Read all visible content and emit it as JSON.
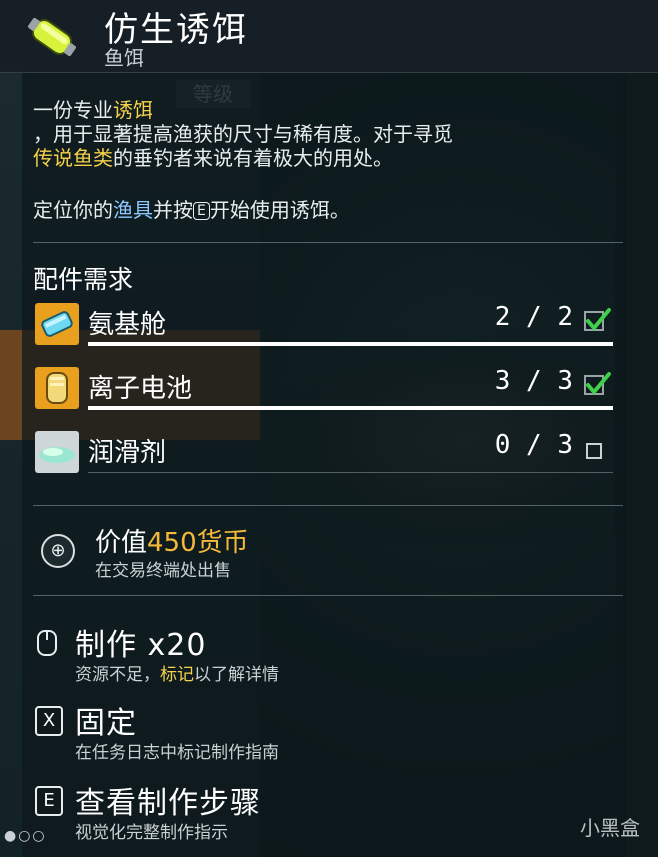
{
  "header": {
    "title": "仿生诱饵",
    "subtitle": "鱼饵",
    "icon": "battery-bait-icon"
  },
  "background": {
    "level_tag": "等级"
  },
  "description": {
    "line1_prefix": "一份专业",
    "line1_highlight": "诱饵",
    "line2": "，用于显著提高渔获的尺寸与稀有度。对于寻觅",
    "line3_highlight": "传说鱼类",
    "line3_suffix": "的垂钓者来说有着极大的用处。",
    "locate_prefix": "定位你的",
    "locate_highlight": "渔具",
    "locate_mid": "并按",
    "locate_key": "E",
    "locate_suffix": "开始使用诱饵。"
  },
  "requirements": {
    "label": "配件需求",
    "items": [
      {
        "name": "氨基舱",
        "have": "2",
        "need": "2",
        "count": "2 / 2",
        "met": true,
        "icon": "amino-chamber-icon",
        "progress": 1.0
      },
      {
        "name": "离子电池",
        "have": "3",
        "need": "3",
        "count": "3 / 3",
        "met": true,
        "icon": "ion-battery-icon",
        "progress": 1.0
      },
      {
        "name": "润滑剂",
        "have": "0",
        "need": "3",
        "count": "0 / 3",
        "met": false,
        "icon": "lubricant-icon",
        "progress": 0.0
      }
    ]
  },
  "value": {
    "prefix": "价值",
    "amount": "450货币",
    "sub": "在交易终端处出售"
  },
  "actions": {
    "craft": {
      "label": "制作 x20",
      "sub_prefix": "资源不足，",
      "sub_highlight": "标记",
      "sub_suffix": "以了解详情"
    },
    "pin": {
      "key": "X",
      "label": "固定",
      "sub": "在任务日志中标记制作指南"
    },
    "steps": {
      "key": "E",
      "label": "查看制作步骤",
      "sub": "视觉化完整制作指示"
    }
  },
  "watermark": "小黑盒",
  "colors": {
    "highlight_yellow": "#f5d24a",
    "highlight_blue": "#8ec8ff",
    "value_amount": "#f5b93a",
    "check_green": "#3fcf4a"
  }
}
